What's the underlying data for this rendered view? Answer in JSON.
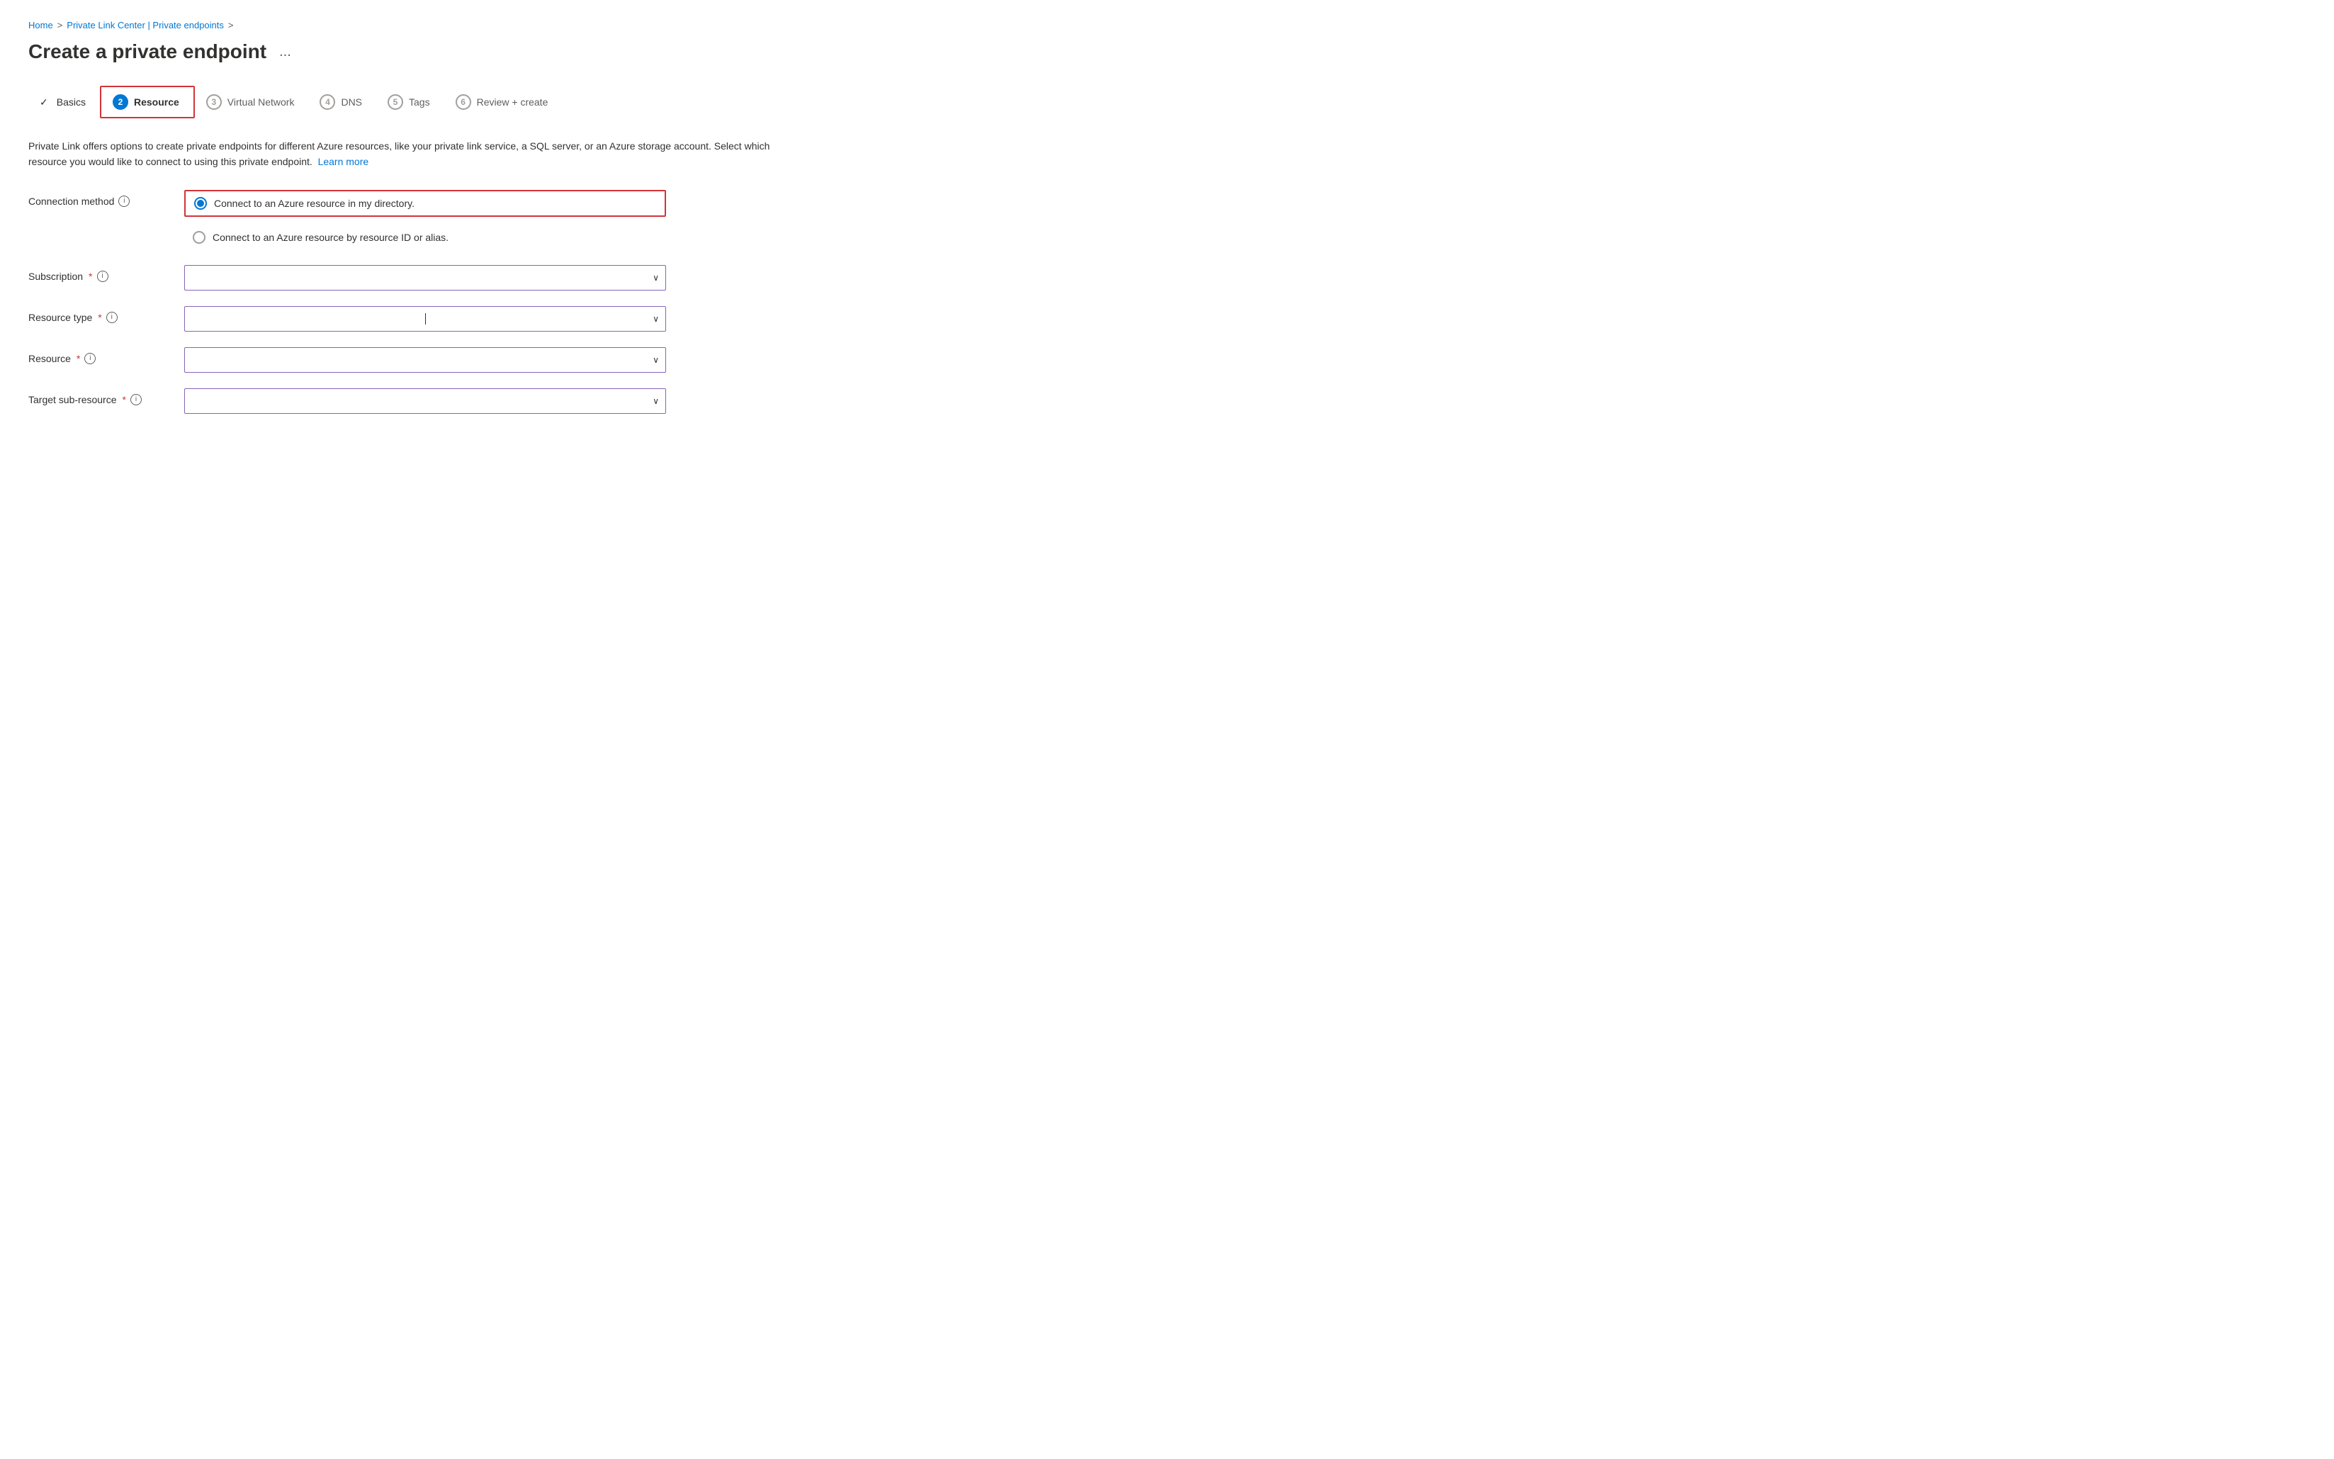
{
  "breadcrumb": {
    "home": "Home",
    "separator1": ">",
    "privateLink": "Private Link Center | Private endpoints",
    "separator2": ">"
  },
  "pageTitle": "Create a private endpoint",
  "ellipsis": "...",
  "tabs": [
    {
      "id": "basics",
      "label": "Basics",
      "number": null,
      "state": "completed",
      "checkmark": true
    },
    {
      "id": "resource",
      "label": "Resource",
      "number": "2",
      "state": "active",
      "checkmark": false
    },
    {
      "id": "virtual-network",
      "label": "Virtual Network",
      "number": "3",
      "state": "default",
      "checkmark": false
    },
    {
      "id": "dns",
      "label": "DNS",
      "number": "4",
      "state": "default",
      "checkmark": false
    },
    {
      "id": "tags",
      "label": "Tags",
      "number": "5",
      "state": "default",
      "checkmark": false
    },
    {
      "id": "review-create",
      "label": "Review + create",
      "number": "6",
      "state": "default",
      "checkmark": false
    }
  ],
  "description": "Private Link offers options to create private endpoints for different Azure resources, like your private link service, a SQL server, or an Azure storage account. Select which resource you would like to connect to using this private endpoint.",
  "learnMoreLabel": "Learn more",
  "form": {
    "connectionMethod": {
      "label": "Connection method",
      "options": [
        {
          "id": "directory",
          "label": "Connect to an Azure resource in my directory.",
          "checked": true
        },
        {
          "id": "resourceId",
          "label": "Connect to an Azure resource by resource ID or alias.",
          "checked": false
        }
      ]
    },
    "subscription": {
      "label": "Subscription",
      "required": true,
      "value": "",
      "placeholder": ""
    },
    "resourceType": {
      "label": "Resource type",
      "required": true,
      "value": "",
      "placeholder": ""
    },
    "resource": {
      "label": "Resource",
      "required": true,
      "value": "",
      "placeholder": ""
    },
    "targetSubResource": {
      "label": "Target sub-resource",
      "required": true,
      "value": "",
      "placeholder": ""
    }
  },
  "icons": {
    "info": "i",
    "checkmark": "✓",
    "chevronDown": "⌄",
    "ellipsis": "···"
  },
  "colors": {
    "azure": "#0078d4",
    "active": "#d13438",
    "border": "#8764b8",
    "disabled": "#a19f9d"
  }
}
